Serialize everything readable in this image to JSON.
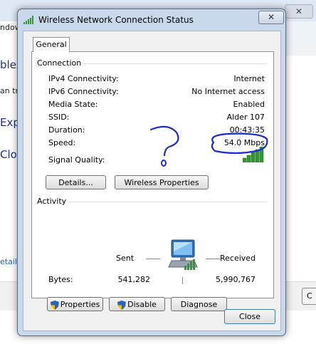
{
  "background": {
    "menu_fragment": "ndow",
    "text_fragments": [
      "bles",
      "Exp",
      "Clo"
    ],
    "small_fragment": "an try",
    "link_fragment": "etail",
    "right_button_fragment": "C",
    "close_glyph": "✕"
  },
  "dialog": {
    "title": "Wireless Network Connection Status",
    "close_glyph": "✕",
    "tab_general": "General",
    "connection": {
      "group_label": "Connection",
      "rows": [
        {
          "label": "IPv4 Connectivity:",
          "value": "Internet"
        },
        {
          "label": "IPv6 Connectivity:",
          "value": "No Internet access"
        },
        {
          "label": "Media State:",
          "value": "Enabled"
        },
        {
          "label": "SSID:",
          "value": "Alder 107"
        },
        {
          "label": "Duration:",
          "value": "00:43:35"
        },
        {
          "label": "Speed:",
          "value": "54.0 Mbps"
        }
      ],
      "signal_label": "Signal Quality:",
      "signal_bars": 5,
      "details_button": "Details...",
      "wireless_properties_button": "Wireless Properties"
    },
    "activity": {
      "group_label": "Activity",
      "sent_label": "Sent",
      "received_label": "Received",
      "bytes_label": "Bytes:",
      "bytes_sent": "541,282",
      "bytes_received": "5,990,767"
    },
    "buttons": {
      "properties": "Properties",
      "disable": "Disable",
      "diagnose": "Diagnose",
      "close": "Close"
    }
  },
  "colors": {
    "annotation_ink": "#1a2bd6",
    "signal_green": "#2d9a2d",
    "title_bar": "#c9d8ea"
  },
  "icons": {
    "title": "wireless-signal-icon",
    "activity": "network-computer-icon",
    "uac": "uac-shield-icon"
  }
}
